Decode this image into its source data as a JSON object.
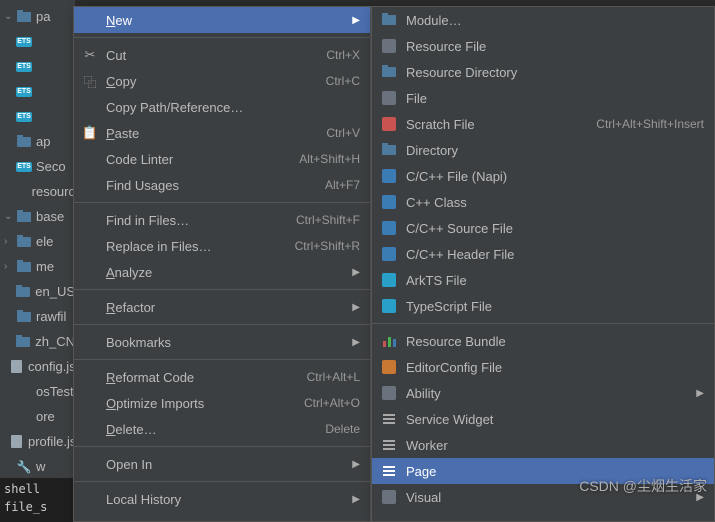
{
  "tree": {
    "items": [
      {
        "chev": "⌄",
        "icon": "folder",
        "label": "pa"
      },
      {
        "chev": "",
        "icon": "ets",
        "label": ""
      },
      {
        "chev": "",
        "icon": "ets",
        "label": ""
      },
      {
        "chev": "",
        "icon": "ets",
        "label": ""
      },
      {
        "chev": "",
        "icon": "ets",
        "label": ""
      },
      {
        "chev": "",
        "icon": "folder",
        "label": "ap"
      },
      {
        "chev": "",
        "icon": "ets",
        "label": "Seco"
      },
      {
        "chev": "",
        "icon": "none",
        "label": "resourc"
      },
      {
        "chev": "⌄",
        "icon": "folder",
        "label": "base"
      },
      {
        "chev": "›",
        "icon": "folder",
        "label": "ele"
      },
      {
        "chev": "›",
        "icon": "folder",
        "label": "me"
      },
      {
        "chev": "",
        "icon": "folder",
        "label": "en_US"
      },
      {
        "chev": "",
        "icon": "folder",
        "label": "rawfil"
      },
      {
        "chev": "",
        "icon": "folder",
        "label": "zh_CN"
      },
      {
        "chev": "",
        "icon": "file",
        "label": "config.js"
      },
      {
        "chev": "",
        "icon": "none",
        "label": "osTest"
      },
      {
        "chev": "",
        "icon": "none",
        "label": "ore"
      },
      {
        "chev": "",
        "icon": "file",
        "label": "profile.js"
      },
      {
        "chev": "",
        "icon": "wrench",
        "label": "w"
      }
    ]
  },
  "shell": {
    "line1": "shell",
    "line2": "file_s"
  },
  "menu1": {
    "items": [
      {
        "icon": "",
        "label": "New",
        "mn": "N",
        "shortcut": "",
        "arrow": true,
        "hl": true
      },
      {
        "sep": true
      },
      {
        "icon": "✂",
        "label": "Cut",
        "mn": "",
        "shortcut": "Ctrl+X"
      },
      {
        "icon": "⿻",
        "label": "Copy",
        "mn": "C",
        "shortcut": "Ctrl+C"
      },
      {
        "icon": "",
        "label": "Copy Path/Reference…",
        "mn": ""
      },
      {
        "icon": "📋",
        "label": "Paste",
        "mn": "P",
        "shortcut": "Ctrl+V"
      },
      {
        "icon": "",
        "label": "Code Linter",
        "mn": "",
        "shortcut": "Alt+Shift+H"
      },
      {
        "icon": "",
        "label": "Find Usages",
        "mn": "",
        "shortcut": "Alt+F7"
      },
      {
        "sep": true
      },
      {
        "icon": "",
        "label": "Find in Files…",
        "mn": "",
        "shortcut": "Ctrl+Shift+F"
      },
      {
        "icon": "",
        "label": "Replace in Files…",
        "mn": "",
        "shortcut": "Ctrl+Shift+R"
      },
      {
        "icon": "",
        "label": "Analyze",
        "mn": "A",
        "arrow": true
      },
      {
        "sep": true
      },
      {
        "icon": "",
        "label": "Refactor",
        "mn": "R",
        "arrow": true
      },
      {
        "sep": true
      },
      {
        "icon": "",
        "label": "Bookmarks",
        "mn": "",
        "arrow": true
      },
      {
        "sep": true
      },
      {
        "icon": "",
        "label": "Reformat Code",
        "mn": "R",
        "shortcut": "Ctrl+Alt+L"
      },
      {
        "icon": "",
        "label": "Optimize Imports",
        "mn": "O",
        "shortcut": "Ctrl+Alt+O"
      },
      {
        "icon": "",
        "label": "Delete…",
        "mn": "D",
        "shortcut": "Delete"
      },
      {
        "sep": true
      },
      {
        "icon": "",
        "label": "Open In",
        "mn": "",
        "arrow": true
      },
      {
        "sep": true
      },
      {
        "icon": "",
        "label": "Local History",
        "mn": "",
        "arrow": true
      }
    ]
  },
  "menu2": {
    "items": [
      {
        "icon": "folder",
        "label": "Module…"
      },
      {
        "icon": "gray",
        "label": "Resource File"
      },
      {
        "icon": "folder",
        "label": "Resource Directory"
      },
      {
        "icon": "gray",
        "label": "File"
      },
      {
        "icon": "red",
        "label": "Scratch File",
        "shortcut": "Ctrl+Alt+Shift+Insert"
      },
      {
        "icon": "folder",
        "label": "Directory"
      },
      {
        "icon": "blue",
        "label": "C/C++ File (Napi)"
      },
      {
        "icon": "blue",
        "label": "C++ Class"
      },
      {
        "icon": "blue",
        "label": "C/C++ Source File"
      },
      {
        "icon": "blue",
        "label": "C/C++ Header File"
      },
      {
        "icon": "teal",
        "label": "ArkTS File"
      },
      {
        "icon": "teal",
        "label": "TypeScript File"
      },
      {
        "sep": true
      },
      {
        "icon": "bars",
        "label": "Resource Bundle"
      },
      {
        "icon": "orange",
        "label": "EditorConfig File"
      },
      {
        "icon": "gray",
        "label": "Ability",
        "arrow": true
      },
      {
        "icon": "lines",
        "label": "Service Widget"
      },
      {
        "icon": "lines",
        "label": "Worker"
      },
      {
        "icon": "lines",
        "label": "Page",
        "hl": true
      },
      {
        "icon": "gray",
        "label": "Visual",
        "arrow": true
      }
    ]
  },
  "watermark": "CSDN @尘烟生活家"
}
